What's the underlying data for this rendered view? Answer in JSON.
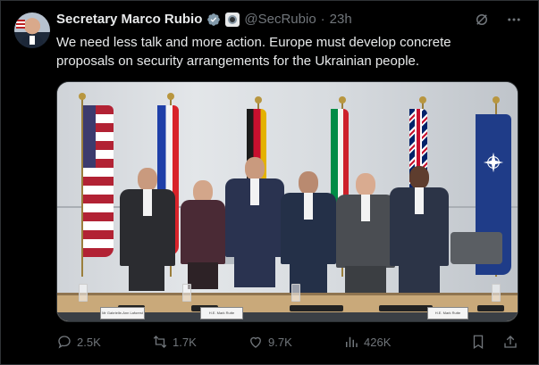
{
  "tweet": {
    "display_name": "Secretary Marco Rubio",
    "handle": "@SecRubio",
    "separator": "·",
    "time": "23h",
    "text": "We need less talk and more action. Europe must develop concrete proposals on security arrangements for the Ukrainian people.",
    "icons": {
      "verified": "verified-badge-icon",
      "government": "government-seal-icon",
      "grok": "grok-icon",
      "more": "more-options-icon"
    }
  },
  "media": {
    "flags": [
      "united-states-flag",
      "france-flag",
      "germany-flag",
      "italy-flag",
      "united-kingdom-flag",
      "nato-flag"
    ],
    "nameplates": [
      "Mr Gabrielle-Ann Laforest",
      "H.E. Mark Rutte",
      "H.E. Mark Rutte"
    ]
  },
  "actions": {
    "replies": "2.5K",
    "reposts": "1.7K",
    "likes": "9.7K",
    "views": "426K"
  },
  "colors": {
    "background": "#000000",
    "text_primary": "#e7e9ea",
    "text_secondary": "#71767b",
    "verified_blue": "#1d9bf0",
    "border": "#2f3336"
  }
}
